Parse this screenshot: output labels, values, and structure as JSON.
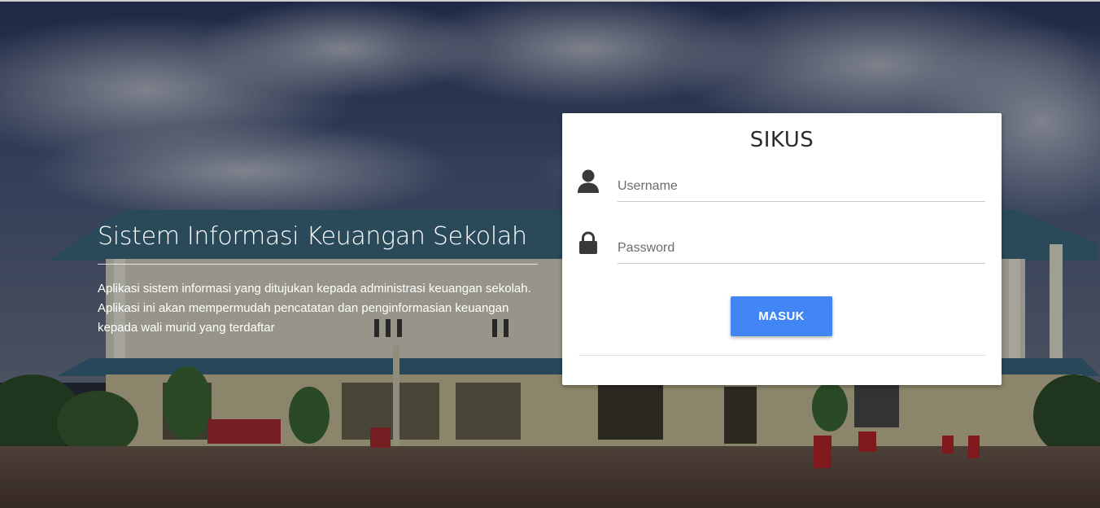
{
  "hero": {
    "title": "Sistem Informasi Keuangan Sekolah",
    "description": "Aplikasi sistem informasi yang ditujukan kepada administrasi keuangan sekolah. Aplikasi ini akan mempermudah pencatatan dan penginformasian keuangan kepada wali murid yang terdaftar"
  },
  "login": {
    "title": "SIKUS",
    "username_placeholder": "Username",
    "username_value": "",
    "password_placeholder": "Password",
    "password_value": "",
    "submit_label": "MASUK"
  },
  "icons": {
    "username": "user-icon",
    "password": "lock-icon"
  },
  "colors": {
    "accent": "#4285f4",
    "card_background": "#ffffff",
    "hero_text": "#ffffff"
  }
}
